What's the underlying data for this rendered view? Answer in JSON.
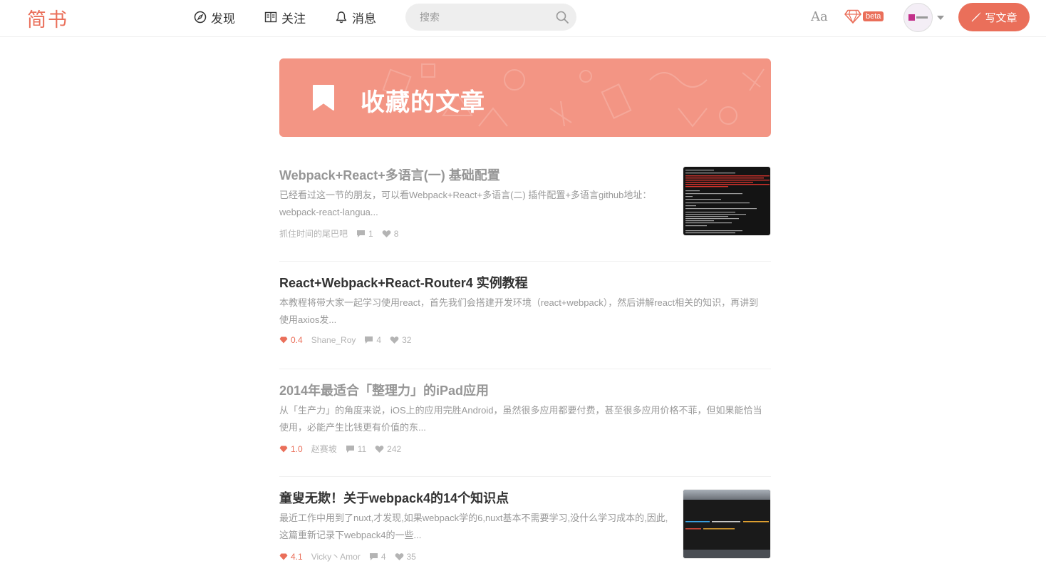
{
  "header": {
    "logo": "简书",
    "nav": [
      {
        "label": "发现",
        "icon": "compass-icon"
      },
      {
        "label": "关注",
        "icon": "book-icon"
      },
      {
        "label": "消息",
        "icon": "bell-icon"
      }
    ],
    "search_placeholder": "搜索",
    "font_toggle": "Aa",
    "beta_tag": "beta",
    "write_label": "写文章"
  },
  "banner": {
    "title": "收藏的文章",
    "icon": "bookmark-icon",
    "color": "#f39584"
  },
  "colors": {
    "brand": "#ea6f5a",
    "title_read": "#969696",
    "title_unread": "#333333",
    "meta": "#b4b4b4"
  },
  "articles": [
    {
      "title": "Webpack+React+多语言(一) 基础配置",
      "read": true,
      "abstract_line1": "已经看过这一节的朋友，可以看Webpack+React+多语言(二) 插件配置+多语言github地址：",
      "abstract_line2": "webpack-react-langua...",
      "jsd": "",
      "author": "抓住时间的尾巴吧",
      "comments": "1",
      "likes": "8",
      "has_thumb": true
    },
    {
      "title": "React+Webpack+React-Router4 实例教程",
      "read": false,
      "abstract_line1": "本教程将带大家一起学习使用react，首先我们会搭建开发环境（react+webpack），然后讲解react相关的知识，再讲到",
      "abstract_line2": "使用axios发...",
      "jsd": "0.4",
      "author": "Shane_Roy",
      "comments": "4",
      "likes": "32",
      "has_thumb": false
    },
    {
      "title": "2014年最适合「整理力」的iPad应用",
      "read": true,
      "abstract_line1": "从「生产力」的角度来说，iOS上的应用完胜Android，虽然很多应用都要付费，甚至很多应用价格不菲，但如果能恰当",
      "abstract_line2": "使用，必能产生比钱更有价值的东...",
      "jsd": "1.0",
      "author": "赵赛坡",
      "comments": "11",
      "likes": "242",
      "has_thumb": false
    },
    {
      "title": "童叟无欺！关于webpack4的14个知识点",
      "read": false,
      "abstract_line1": "最近工作中用到了nuxt,才发现,如果webpack学的6,nuxt基本不需要学习,没什么学习成本的,因此,",
      "abstract_line2": "这篇重新记录下webpack4的一些...",
      "jsd": "4.1",
      "author": "Vicky丶Amor",
      "comments": "4",
      "likes": "35",
      "has_thumb": true
    }
  ]
}
